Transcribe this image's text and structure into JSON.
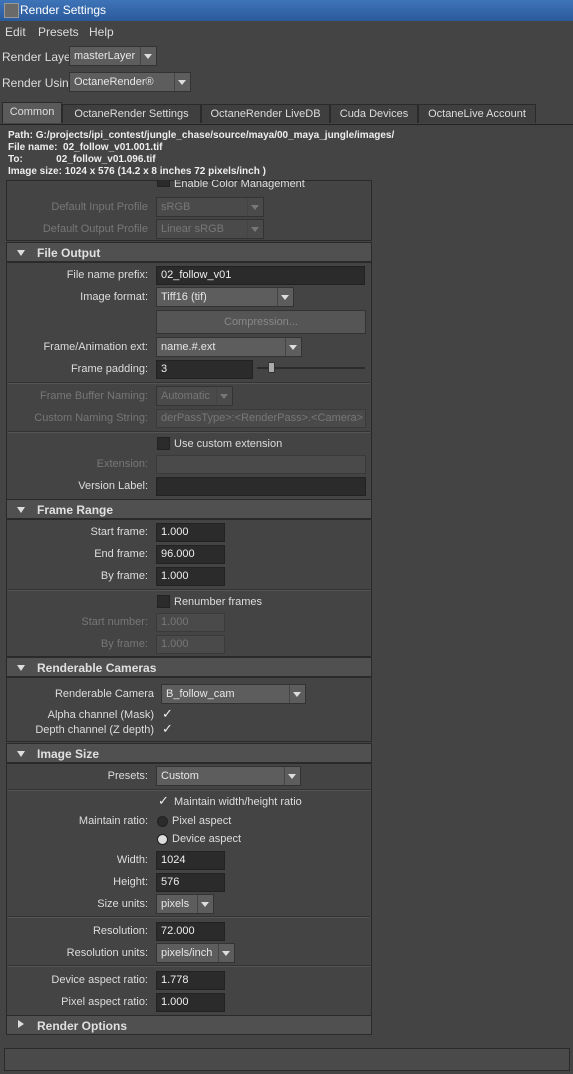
{
  "window": {
    "title": "Render Settings"
  },
  "menu": [
    "Edit",
    "Presets",
    "Help"
  ],
  "render_layer": {
    "label": "Render Layer",
    "value": "masterLayer"
  },
  "render_using": {
    "label": "Render Using",
    "value": "OctaneRender®"
  },
  "tabs": [
    "Common",
    "OctaneRender Settings",
    "OctaneRender LiveDB",
    "Cuda Devices",
    "OctaneLive Account"
  ],
  "info": {
    "path": "Path: G:/projects/ipi_contest/jungle_chase/source/maya/00_maya_jungle/images/",
    "file_name": "File name:  02_follow_v01.001.tif",
    "to": "To:            02_follow_v01.096.tif",
    "image_size": "Image size: 1024 x 576 (14.2 x 8 inches 72 pixels/inch )"
  },
  "color_mgmt": {
    "enable_label": "Enable Color Management",
    "input_profile_label": "Default Input Profile",
    "input_profile_value": "sRGB",
    "output_profile_label": "Default Output Profile",
    "output_profile_value": "Linear sRGB"
  },
  "file_output": {
    "title": "File Output",
    "prefix_label": "File name prefix:",
    "prefix_value": "02_follow_v01",
    "format_label": "Image format:",
    "format_value": "Tiff16 (tif)",
    "compression_label": "Compression...",
    "ext_label": "Frame/Animation ext:",
    "ext_value": "name.#.ext",
    "padding_label": "Frame padding:",
    "padding_value": "3",
    "buffer_label": "Frame Buffer Naming:",
    "buffer_value": "Automatic",
    "custom_naming_label": "Custom Naming String:",
    "custom_naming_value": "derPassType>:<RenderPass>.<Camera>",
    "use_custom_ext_label": "Use custom extension",
    "extension_label": "Extension:",
    "version_label": "Version Label:"
  },
  "frame_range": {
    "title": "Frame Range",
    "start_label": "Start frame:",
    "start_value": "1.000",
    "end_label": "End frame:",
    "end_value": "96.000",
    "by_label": "By frame:",
    "by_value": "1.000",
    "renumber_label": "Renumber frames",
    "start_number_label": "Start number:",
    "start_number_value": "1.000",
    "by_frame2_label": "By frame:",
    "by_frame2_value": "1.000"
  },
  "cameras": {
    "title": "Renderable Cameras",
    "camera_label": "Renderable Camera",
    "camera_value": "B_follow_cam",
    "alpha_label": "Alpha channel (Mask)",
    "depth_label": "Depth channel (Z depth)",
    "check_mark": "✓"
  },
  "image_size": {
    "title": "Image Size",
    "presets_label": "Presets:",
    "presets_value": "Custom",
    "maintain_label": "Maintain width/height ratio",
    "maintain_ratio_label": "Maintain ratio:",
    "pixel_aspect_label": "Pixel aspect",
    "device_aspect_label": "Device aspect",
    "width_label": "Width:",
    "width_value": "1024",
    "height_label": "Height:",
    "height_value": "576",
    "size_units_label": "Size units:",
    "size_units_value": "pixels",
    "resolution_label": "Resolution:",
    "resolution_value": "72.000",
    "res_units_label": "Resolution units:",
    "res_units_value": "pixels/inch",
    "device_ratio_label": "Device aspect ratio:",
    "device_ratio_value": "1.778",
    "pixel_ratio_label": "Pixel aspect ratio:",
    "pixel_ratio_value": "1.000"
  },
  "render_options": {
    "title": "Render Options"
  },
  "colors": {
    "title_bar": "#2a5a9c",
    "panel": "#444444",
    "section": "#505050",
    "field": "#2b2b2b"
  }
}
